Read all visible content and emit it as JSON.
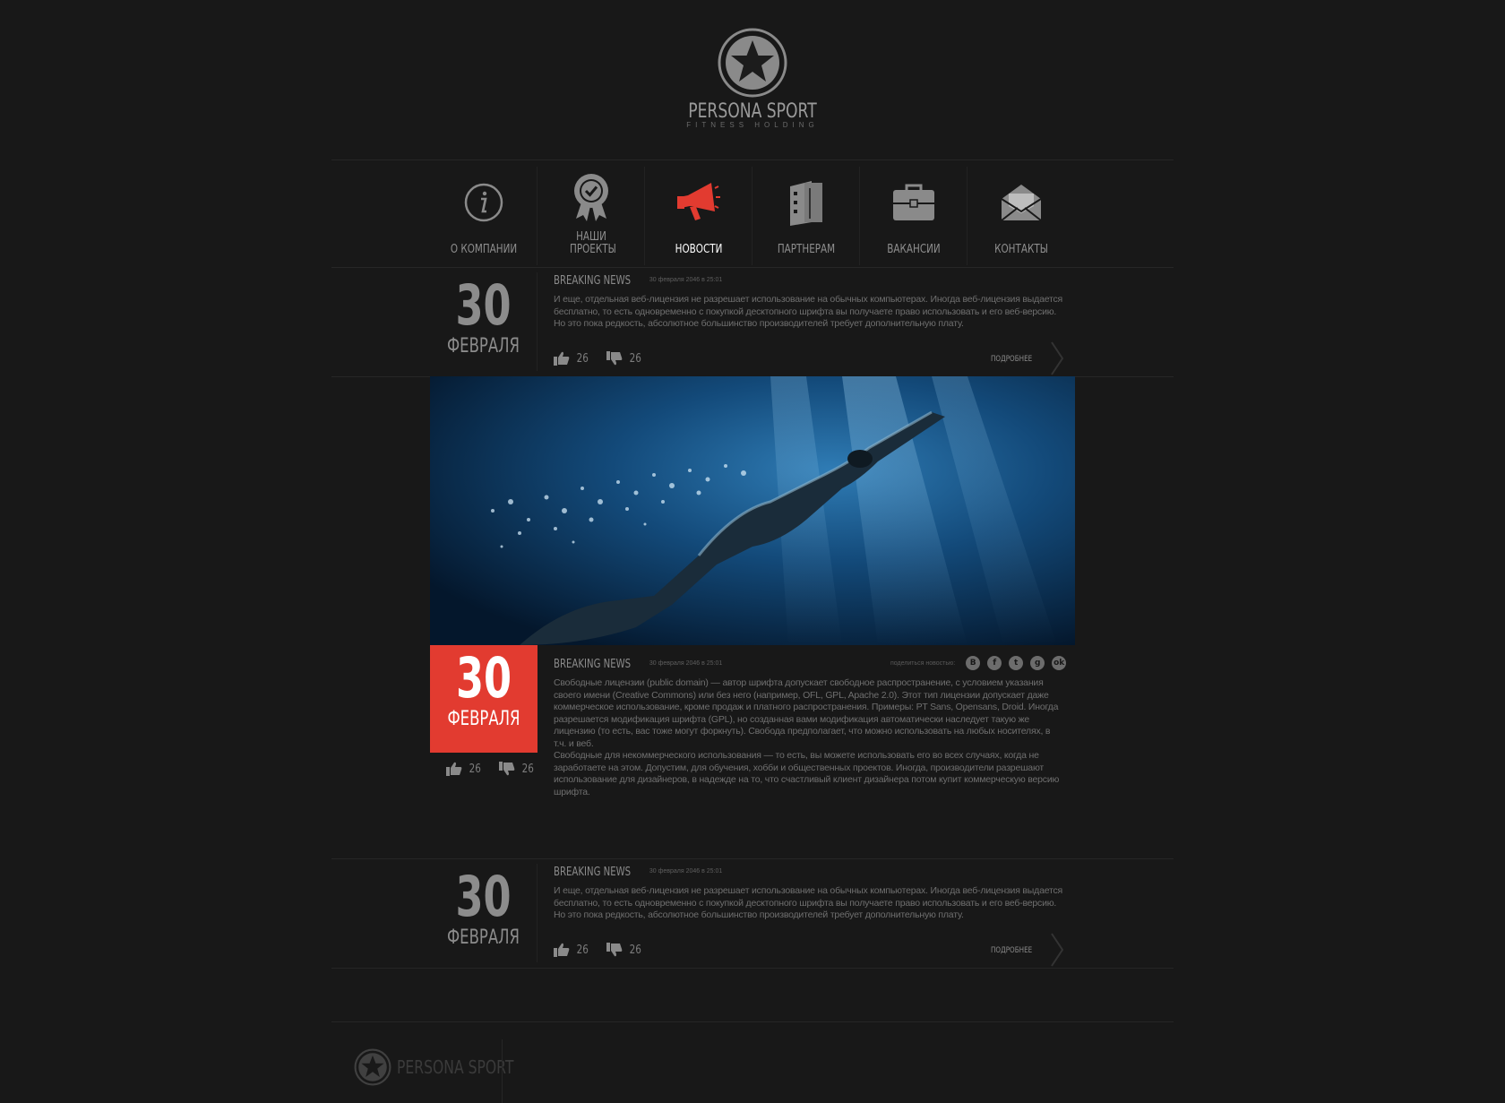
{
  "brand": {
    "name": "PERSONA SPORT",
    "tagline": "FITNESS HOLDING"
  },
  "nav": {
    "items": [
      {
        "label": "О КОМПАНИИ",
        "icon": "info-icon"
      },
      {
        "label": "НАШИ ПРОЕКТЫ",
        "icon": "award-badge-icon"
      },
      {
        "label": "НОВОСТИ",
        "icon": "megaphone-icon",
        "active": true
      },
      {
        "label": "ПАРТНЕРАМ",
        "icon": "folder-document-icon"
      },
      {
        "label": "ВАКАНСИИ",
        "icon": "briefcase-icon"
      },
      {
        "label": "КОНТАКТЫ",
        "icon": "envelope-icon"
      }
    ]
  },
  "news": [
    {
      "day": "30",
      "month": "ФЕВРАЛЯ",
      "title": "BREAKING NEWS",
      "date": "30 февраля 2046 в 25:01",
      "text": "И еще, отдельная веб-лицензия не разрешает использование на обычных компьютерах. Иногда веб-лицензия выдается бесплатно, то есть одновременно с покупкой десктопного шрифта вы получаете право использовать и его веб-версию. Но это пока редкость, абсолютное большинство производителей требует дополнительную плату.",
      "likes": "26",
      "dislikes": "26",
      "more": "ПОДРОБНЕЕ"
    },
    {
      "day": "30",
      "month": "ФЕВРАЛЯ",
      "title": "BREAKING NEWS",
      "date": "30 февраля 2046 в 25:01",
      "share_label": "поделиться новостью:",
      "text1": "Свободные лицензии (public domain) — автор шрифта допускает свободное распространение, с условием указания своего имени (Creative Commons) или без него (например, OFL, GPL, Apache 2.0). Этот тип лицензии допускает даже коммерческое использование, кроме продаж и платного распространения. Примеры: PT Sans, Opensans, Droid. Иногда разрешается модификация шрифта (GPL), но созданная вами модификация автоматически наследует такую же лицензию (то есть, вас тоже могут форкнуть). Свобода предполагает, что можно использовать на любых носителях, в т.ч. и веб.",
      "text2": "Свободные для некоммерческого использования — то есть, вы можете использовать его во всех случаях, когда не заработаете на этом. Допустим, для обучения, хобби и общественных проектов. Иногда, производители разрешают использование для дизайнеров, в надежде на то, что счастливый клиент дизайнера потом купит коммерческую версию шрифта.",
      "likes": "26",
      "dislikes": "26",
      "share_icons": [
        "В",
        "f",
        "t",
        "g",
        "ok"
      ]
    },
    {
      "day": "30",
      "month": "ФЕВРАЛЯ",
      "title": "BREAKING NEWS",
      "date": "30 февраля 2046 в 25:01",
      "text": "И еще, отдельная веб-лицензия не разрешает использование на обычных компьютерах. Иногда веб-лицензия выдается бесплатно, то есть одновременно с покупкой десктопного шрифта вы получаете право использовать и его веб-версию. Но это пока редкость, абсолютное большинство производителей требует дополнительную плату.",
      "likes": "26",
      "dislikes": "26",
      "more": "ПОДРОБНЕЕ"
    }
  ],
  "footer": {
    "brand": "PERSONA SPORT"
  },
  "colors": {
    "background": "#181818",
    "accent": "#e23b30"
  }
}
